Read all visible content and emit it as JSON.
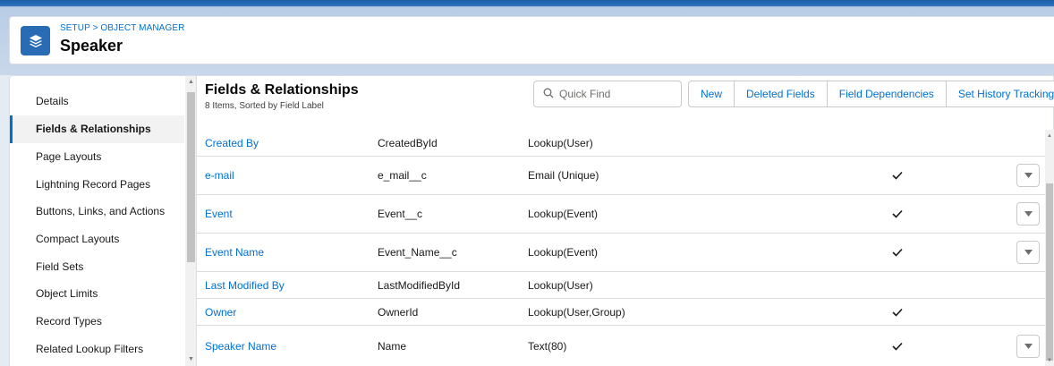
{
  "header": {
    "breadcrumb": {
      "setup": "SETUP",
      "separator": ">",
      "object_manager": "OBJECT MANAGER"
    },
    "title": "Speaker",
    "icon": "layers-icon"
  },
  "sidebar": {
    "items": [
      {
        "label": "Details",
        "active": false
      },
      {
        "label": "Fields & Relationships",
        "active": true
      },
      {
        "label": "Page Layouts",
        "active": false
      },
      {
        "label": "Lightning Record Pages",
        "active": false
      },
      {
        "label": "Buttons, Links, and Actions",
        "active": false
      },
      {
        "label": "Compact Layouts",
        "active": false
      },
      {
        "label": "Field Sets",
        "active": false
      },
      {
        "label": "Object Limits",
        "active": false
      },
      {
        "label": "Record Types",
        "active": false
      },
      {
        "label": "Related Lookup Filters",
        "active": false
      }
    ]
  },
  "main": {
    "title": "Fields & Relationships",
    "subtitle": "8 Items, Sorted by Field Label",
    "search": {
      "placeholder": "Quick Find",
      "icon": "search-icon"
    },
    "buttons": {
      "new": "New",
      "deleted_fields": "Deleted Fields",
      "field_dependencies": "Field Dependencies",
      "set_history_tracking": "Set History Tracking"
    },
    "rows": [
      {
        "label": "Created By",
        "api_name": "CreatedById",
        "type": "Lookup(User)",
        "indexed": false,
        "has_menu": false
      },
      {
        "label": "e-mail",
        "api_name": "e_mail__c",
        "type": "Email (Unique)",
        "indexed": true,
        "has_menu": true
      },
      {
        "label": "Event",
        "api_name": "Event__c",
        "type": "Lookup(Event)",
        "indexed": true,
        "has_menu": true
      },
      {
        "label": "Event Name",
        "api_name": "Event_Name__c",
        "type": "Lookup(Event)",
        "indexed": true,
        "has_menu": true
      },
      {
        "label": "Last Modified By",
        "api_name": "LastModifiedById",
        "type": "Lookup(User)",
        "indexed": false,
        "has_menu": false
      },
      {
        "label": "Owner",
        "api_name": "OwnerId",
        "type": "Lookup(User,Group)",
        "indexed": true,
        "has_menu": false
      },
      {
        "label": "Speaker Name",
        "api_name": "Name",
        "type": "Text(80)",
        "indexed": true,
        "has_menu": true
      }
    ]
  },
  "colors": {
    "link": "#0070d2",
    "brand": "#2a6bb6",
    "border": "#d8dde6"
  }
}
